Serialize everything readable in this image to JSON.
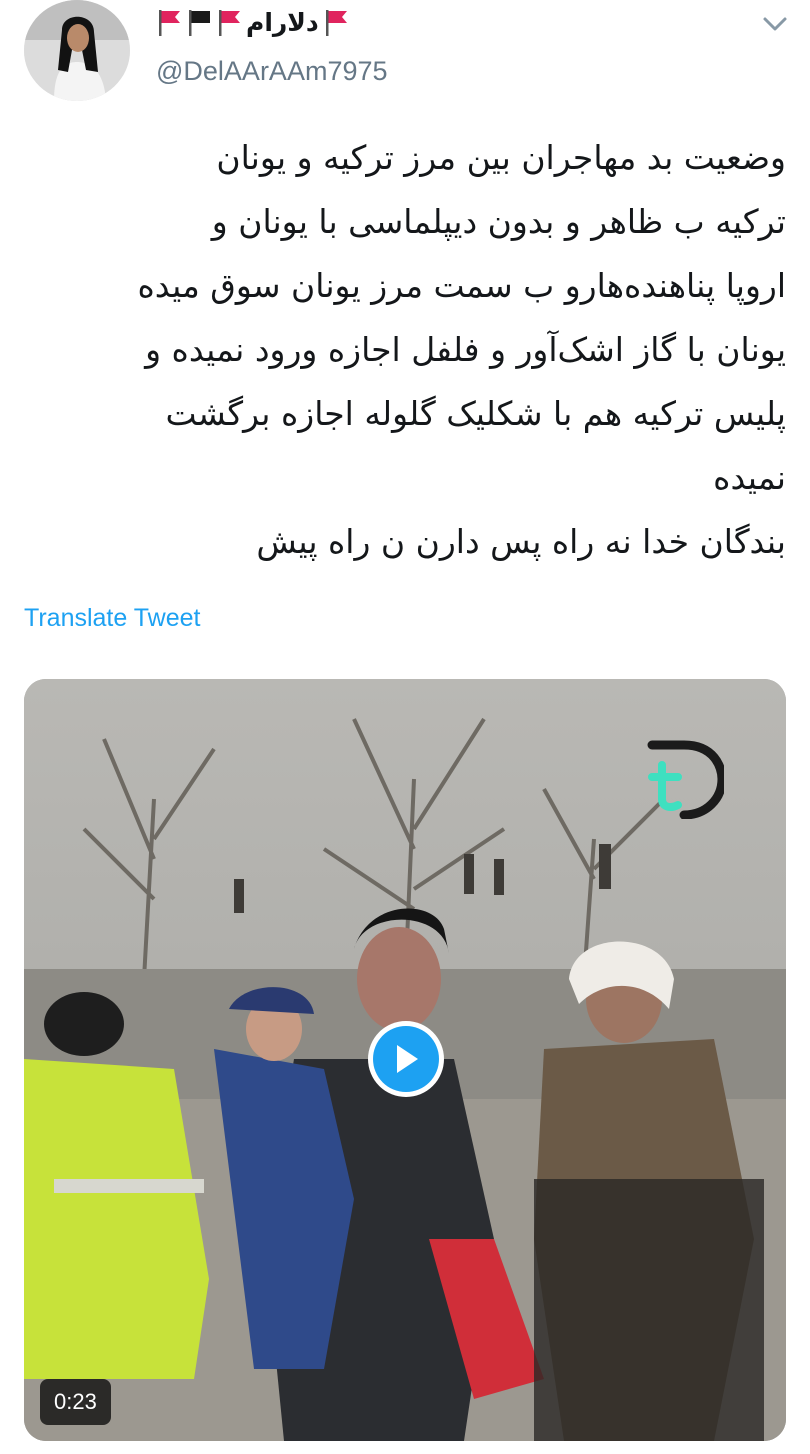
{
  "tweet": {
    "display_name": "دلارام",
    "handle": "@DelAArAAm7975",
    "avatar_icon": "user-avatar-photo",
    "flags": [
      "red-flag",
      "red-flag",
      "black-flag",
      "red-flag"
    ],
    "menu_icon": "chevron-down-icon",
    "text_lines": [
      "وضعیت بد مهاجران بین مرز ترکیه و یونان",
      "ترکیه ب ظاهر و بدون دیپلماسی با یونان و",
      "اروپا پناهنده‌هارو ب سمت مرز یونان سوق میده",
      "یونان با گاز اشک‌آور و فلفل اجازه ورود نمیده و",
      "پلیس ترکیه هم با شکلیک گلوله اجازه برگشت",
      "نمیده",
      "بندگان خدا نه راه پس دارن ن راه پیش"
    ],
    "translate_label": "Translate Tweet"
  },
  "media": {
    "type": "video",
    "duration": "0:23",
    "play_icon": "play-icon",
    "watermark_icon": "channel-logo-icon"
  },
  "colors": {
    "accent": "#1da1f2",
    "text": "#14171a",
    "secondary_text": "#657786",
    "flag_red": "#e0245e",
    "flag_black": "#1a1a1a"
  }
}
